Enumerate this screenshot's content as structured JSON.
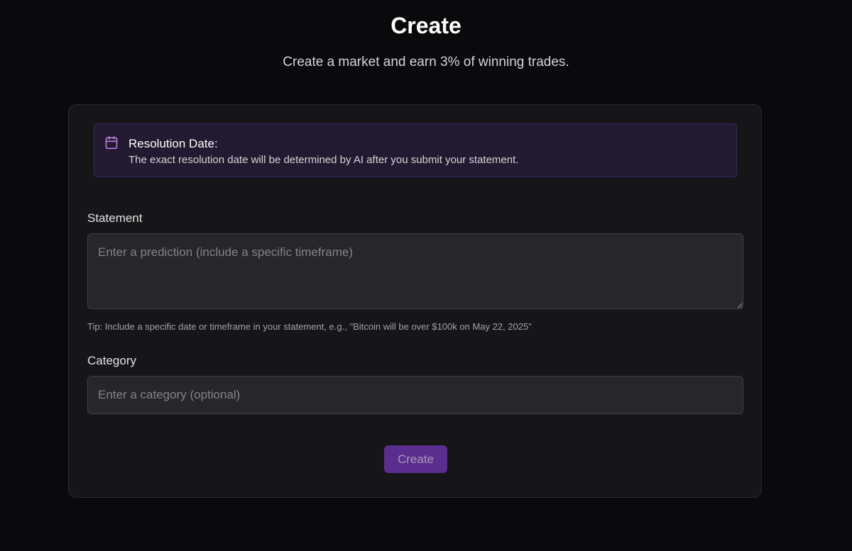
{
  "header": {
    "title": "Create",
    "subtitle": "Create a market and earn 3% of winning trades."
  },
  "notice": {
    "icon": "calendar-icon",
    "title": "Resolution Date:",
    "text": "The exact resolution date will be determined by AI after you submit your statement."
  },
  "form": {
    "statement_label": "Statement",
    "statement_value": "",
    "statement_placeholder": "Enter a prediction (include a specific timeframe)",
    "tip": "Tip: Include a specific date or timeframe in your statement, e.g., \"Bitcoin will be over $100k on May 22, 2025\"",
    "category_label": "Category",
    "category_value": "",
    "category_placeholder": "Enter a category (optional)",
    "submit_label": "Create"
  },
  "colors": {
    "background": "#0a0a0c",
    "card": "#161618",
    "accent": "#5b2d8f",
    "notice_bg": "#221a30",
    "icon": "#b57edc"
  }
}
